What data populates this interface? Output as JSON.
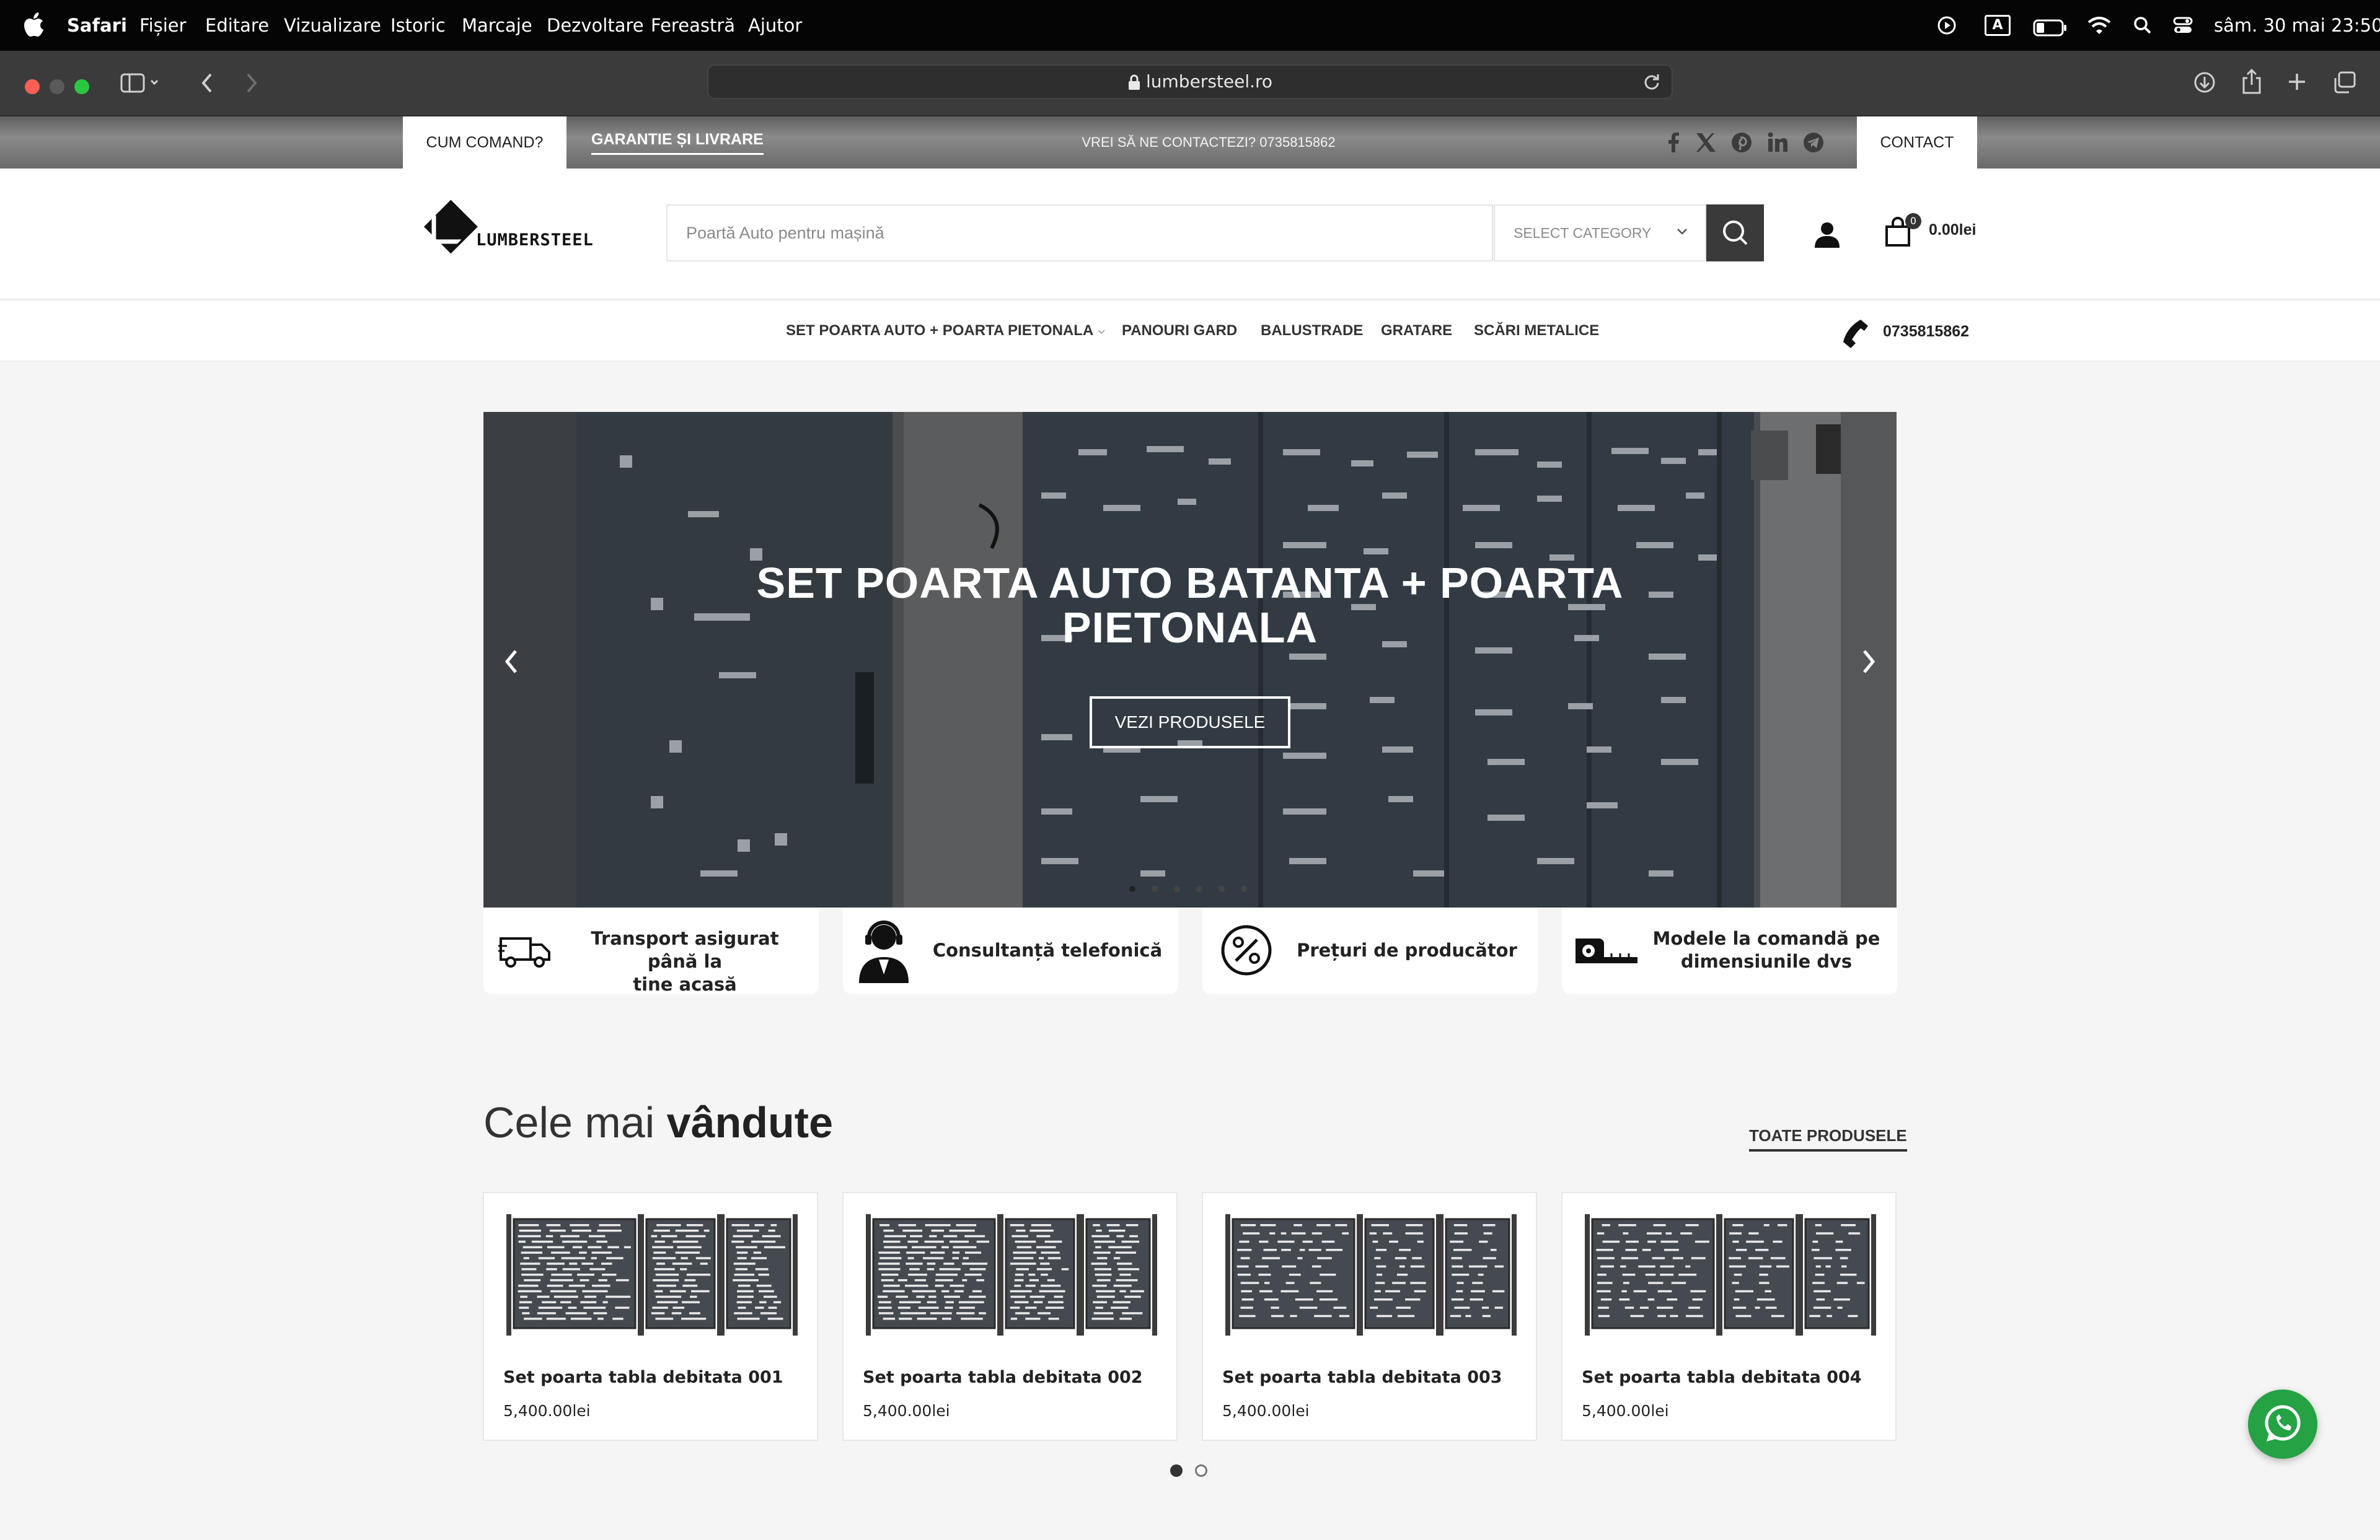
{
  "menubar": {
    "app": "Safari",
    "items": [
      "Fișier",
      "Editare",
      "Vizualizare",
      "Istoric",
      "Marcaje",
      "Dezvoltare",
      "Fereastră",
      "Ajutor"
    ],
    "input_indicator": "A",
    "clock": "sâm. 30 mai  23:50"
  },
  "browser": {
    "url": "lumbersteel.ro"
  },
  "topbar": {
    "how_to_order": "CUM COMAND?",
    "warranty": "GARANTIE ȘI LIVRARE",
    "contact_prompt": "VREI SĂ NE CONTACTEZI? 0735815862",
    "contact": "CONTACT",
    "social": [
      "facebook-icon",
      "x-icon",
      "pinterest-icon",
      "linkedin-icon",
      "telegram-icon"
    ]
  },
  "header": {
    "logo_text": "LUMBERSTEEL",
    "search_placeholder": "Poartă Auto pentru mașină",
    "category": "SELECT CATEGORY",
    "cart_count": "0",
    "cart_total": "0.00lei"
  },
  "nav": {
    "items": [
      "SET POARTA AUTO + POARTA PIETONALA",
      "PANOURI GARD",
      "BALUSTRADE",
      "GRATARE",
      "SCĂRI METALICE"
    ],
    "phone": "0735815862"
  },
  "hero": {
    "title_line1": "SET POARTA AUTO BATANTA + POARTA",
    "title_line2": "PIETONALA",
    "cta": "VEZI PRODUSELE",
    "slide_count": 6,
    "active_slide": 1
  },
  "features": [
    {
      "line1": "Transport asigurat până la",
      "line2": "tine acasă",
      "icon": "truck-icon"
    },
    {
      "line1": "Consultanță telefonică",
      "line2": "",
      "icon": "support-agent-icon"
    },
    {
      "line1": "Prețuri de producător",
      "line2": "",
      "icon": "percent-icon"
    },
    {
      "line1": "Modele la comandă pe",
      "line2": "dimensiunile dvs",
      "icon": "tape-measure-icon"
    }
  ],
  "bestsellers": {
    "title_regular": "Cele mai ",
    "title_bold": "vândute",
    "all_link": "TOATE PRODUSELE",
    "products": [
      {
        "name": "Set poarta tabla debitata 001",
        "price": "5,400.00lei"
      },
      {
        "name": "Set poarta tabla debitata 002",
        "price": "5,400.00lei"
      },
      {
        "name": "Set poarta tabla debitata 003",
        "price": "5,400.00lei"
      },
      {
        "name": "Set poarta tabla debitata 004",
        "price": "5,400.00lei"
      }
    ],
    "page_count": 2,
    "active_page": 1
  },
  "colors": {
    "accent": "#3a3a3a",
    "whatsapp": "#25a244",
    "menubar": "#050505",
    "toolbar": "#3b3b3b"
  }
}
